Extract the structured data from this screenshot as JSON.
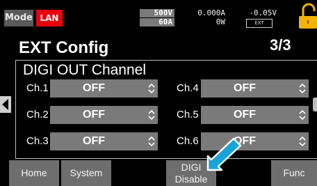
{
  "status": {
    "mode_label": "Mode",
    "lan_label": "LAN",
    "voltage_limit": "500V",
    "current_limit": "60A",
    "current_reading": "0.000A",
    "power_reading": "0W",
    "voltage_reading": "-0.05V",
    "ext_label": "EXT"
  },
  "header": {
    "title": "EXT Config",
    "page": "3/3"
  },
  "panel": {
    "title": "DIGI OUT Channel",
    "channels": [
      {
        "label": "Ch.1",
        "value": "OFF"
      },
      {
        "label": "Ch.2",
        "value": "OFF"
      },
      {
        "label": "Ch.3",
        "value": "OFF"
      },
      {
        "label": "Ch.4",
        "value": "OFF"
      },
      {
        "label": "Ch.5",
        "value": "OFF"
      },
      {
        "label": "Ch.6",
        "value": "OFF"
      }
    ]
  },
  "softkeys": {
    "home": "Home",
    "system": "System",
    "digi_line1": "DIGI",
    "digi_line2": "Disable",
    "func": "Func"
  },
  "icons": {
    "lock": "lock-icon",
    "updown": "updown-arrows-icon",
    "nav_left": "triangle-left-icon",
    "pointer": "pointer-arrow-icon"
  },
  "colors": {
    "lan": "#e8000c",
    "lock": "#f2b400",
    "pointer": "#1aa3d9",
    "control": "#7a7a7a"
  }
}
